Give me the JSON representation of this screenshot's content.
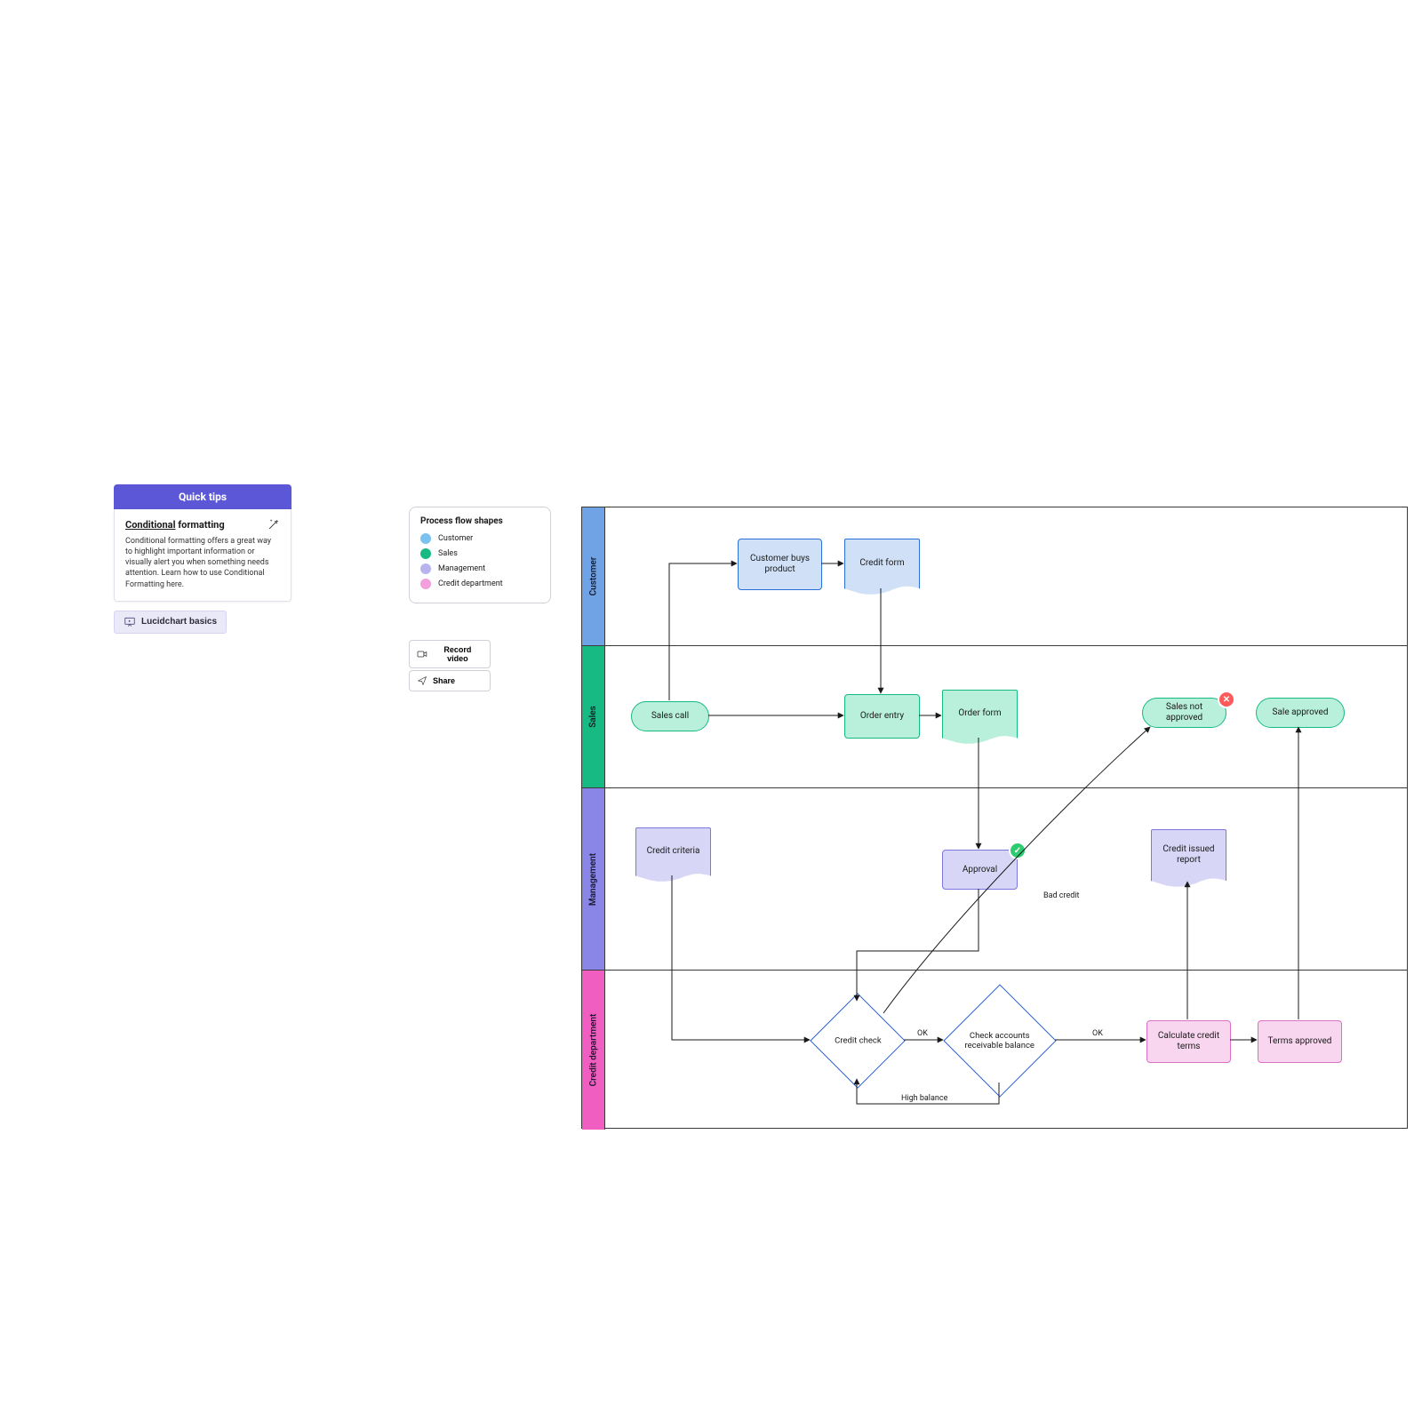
{
  "tips": {
    "header": "Quick tips",
    "title_underlined": "Conditional",
    "title_rest": " formatting",
    "body": "Conditional formatting offers a great way to highlight important information or visually alert you when something needs attention. Learn how to use Conditional Formatting here.",
    "basics_button": "Lucidchart basics"
  },
  "legend": {
    "title": "Process flow shapes",
    "items": [
      {
        "label": "Customer",
        "color": "#7bc2f0"
      },
      {
        "label": "Sales",
        "color": "#17ba82"
      },
      {
        "label": "Management",
        "color": "#b6b3f0"
      },
      {
        "label": "Credit department",
        "color": "#f29fdc"
      }
    ]
  },
  "actions": {
    "record": "Record video",
    "share": "Share"
  },
  "lanes": [
    {
      "id": "customer",
      "label": "Customer"
    },
    {
      "id": "sales",
      "label": "Sales"
    },
    {
      "id": "management",
      "label": "Management"
    },
    {
      "id": "credit",
      "label": "Credit department"
    }
  ],
  "nodes": {
    "sales_call": "Sales call",
    "cust_buys": "Customer buys product",
    "credit_form": "Credit form",
    "order_entry": "Order entry",
    "order_form": "Order form",
    "sales_not_appr": "Sales not approved",
    "sale_approved": "Sale approved",
    "credit_criteria": "Credit criteria",
    "approval": "Approval",
    "credit_issued_rpt": "Credit issued report",
    "credit_check": "Credit check",
    "check_ar_balance": "Check accounts receivable balance",
    "calc_terms": "Calculate credit terms",
    "terms_approved": "Terms approved"
  },
  "edge_labels": {
    "ok": "OK",
    "bad_credit": "Bad credit",
    "high_balance": "High balance"
  }
}
